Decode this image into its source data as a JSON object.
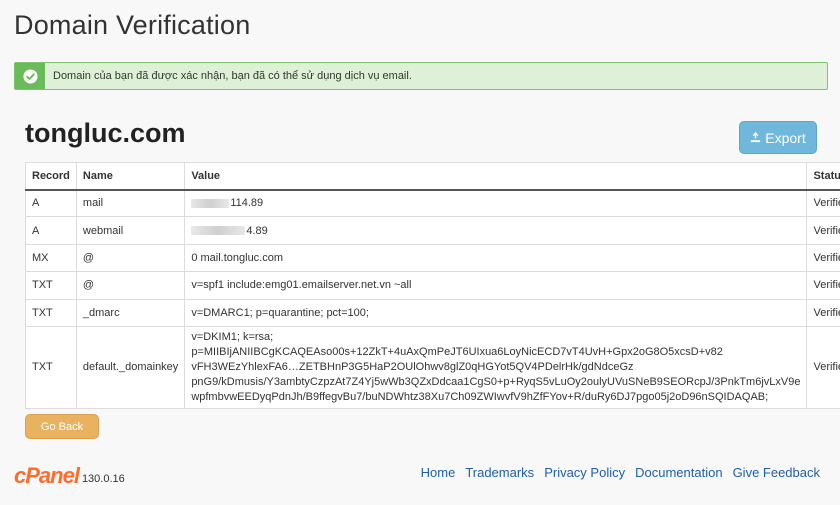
{
  "page": {
    "title": "Domain Verification"
  },
  "alert": {
    "message": "Domain của bạn đã được xác nhận, bạn đã có thể sử dụng dịch vụ email.",
    "color": "#dff0d8",
    "icon": "check-circle-icon"
  },
  "domain": {
    "name": "tongluc.com"
  },
  "export": {
    "label": "Export",
    "icon": "export-icon",
    "color": "#6fb8db"
  },
  "table": {
    "headers": {
      "record": "Record",
      "name": "Name",
      "value": "Value",
      "status": "Status"
    },
    "rows": [
      {
        "record": "A",
        "name": "mail",
        "value": "114.89",
        "status": "Verified"
      },
      {
        "record": "A",
        "name": "webmail",
        "value": "4.89",
        "status": "Verified"
      },
      {
        "record": "MX",
        "name": "@",
        "value": "0 mail.tongluc.com",
        "status": "Verified"
      },
      {
        "record": "TXT",
        "name": "@",
        "value": "v=spf1 include:emg01.emailserver.net.vn ~all",
        "status": "Verified"
      },
      {
        "record": "TXT",
        "name": "_dmarc",
        "value": "v=DMARC1; p=quarantine; pct=100;",
        "status": "Verified"
      },
      {
        "record": "TXT",
        "name": "default._domainkey",
        "value_lines": [
          "v=DKIM1; k=rsa; p=MIIBIjANIIBCgKCAQEAso00s+12ZkT+4uAxQmPeJT6UIxua6LoyNicECD7vT4UvH+Gpx2oG8O5xcsD+v82",
          "vFH3WEzYhlexFA6…ZETBHnP3G5HaP2OUlOhwv8glZ0qHGYot5QV4PDelrHk/gdNdceGz",
          "pnG9/kDmusis/Y3ambtyCzpzAt7Z4Yj5wWb3QZxDdcaa1CgS0+p+RyqS5vLuOy2oulyUVuSNeB9SEORcpJ/3PnkTm6jvLxV9e",
          "wpfmbvwEEDyqPdnJh/B9ffegvBu7/buNDWhtz38Xu7Ch09ZWIwvfV9hZfFYov+R/duRy6DJ7pgo05j2oD96nSQIDAQAB;"
        ],
        "status": "Verified"
      }
    ]
  },
  "goback": {
    "label": "Go Back",
    "color": "#e9b261"
  },
  "footer": {
    "logo": "cPanel",
    "version": "130.0.16",
    "links": [
      "Home",
      "Trademarks",
      "Privacy Policy",
      "Documentation",
      "Give Feedback"
    ]
  }
}
